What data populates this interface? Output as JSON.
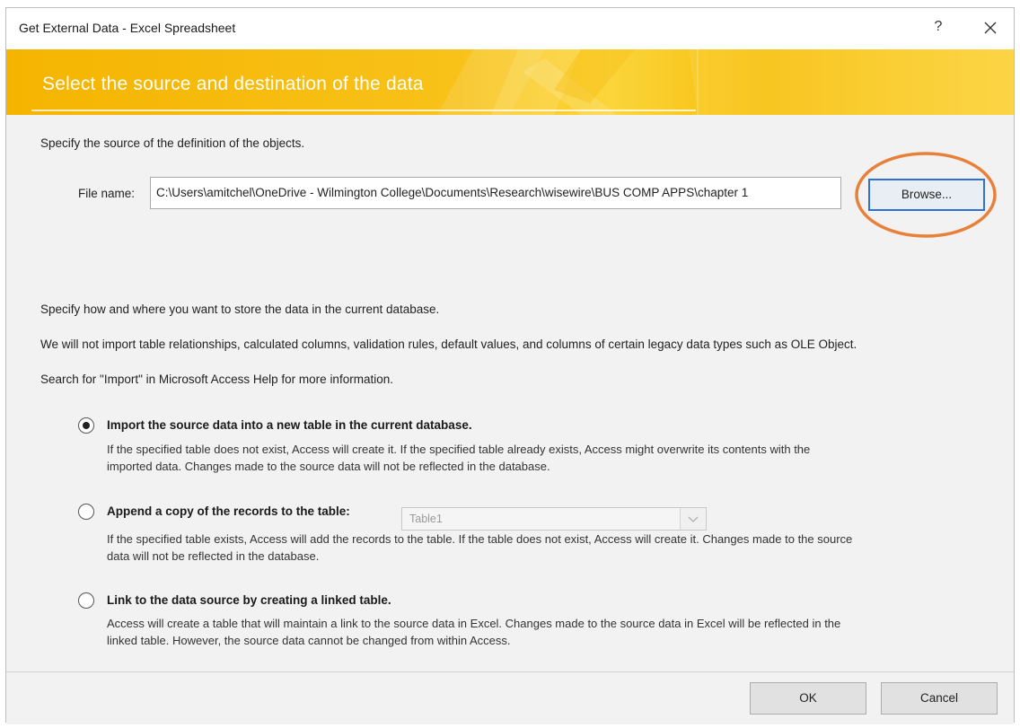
{
  "window": {
    "title": "Get External Data - Excel Spreadsheet",
    "help_label": "?",
    "close_icon": "close-icon"
  },
  "banner": {
    "title": "Select the source and destination of the data"
  },
  "source": {
    "instruction": "Specify the source of the definition of the objects.",
    "file_label": "File name:",
    "file_value": "C:\\Users\\amitchel\\OneDrive - Wilmington College\\Documents\\Research\\wisewire\\BUS COMP APPS\\chapter 1",
    "browse_label": "Browse...",
    "highlight_color": "#e8803a"
  },
  "info": {
    "line1": "Specify how and where you want to store the data in the current database.",
    "line2": "We will not import table relationships, calculated columns, validation rules, default values, and columns of certain legacy data types such as OLE Object.",
    "line3": "Search for \"Import\" in Microsoft Access Help for more information."
  },
  "options": [
    {
      "label": "Import the source data into a new table in the current database.",
      "selected": true,
      "desc1": "If the specified table does not exist, Access will create it. If the specified table already exists, Access might overwrite its contents with the",
      "desc2": "imported data. Changes made to the source data will not be reflected in the database."
    },
    {
      "label": "Append a copy of the records to the table:",
      "selected": false,
      "select_value": "Table1",
      "desc1": "If the specified table exists, Access will add the records to the table. If the table does not exist, Access will create it. Changes made to the source",
      "desc2": "data will not be reflected in the database."
    },
    {
      "label": "Link to the data source by creating a linked table.",
      "selected": false,
      "desc1": "Access will create a table that will maintain a link to the source data in Excel. Changes made to the source data in Excel will be reflected in the",
      "desc2": "linked table. However, the source data cannot be changed from within Access."
    }
  ],
  "footer": {
    "ok_label": "OK",
    "cancel_label": "Cancel"
  },
  "colors": {
    "banner": "#f5b400",
    "focus_border": "#2f6fd6",
    "panel": "#f2f2f2"
  }
}
